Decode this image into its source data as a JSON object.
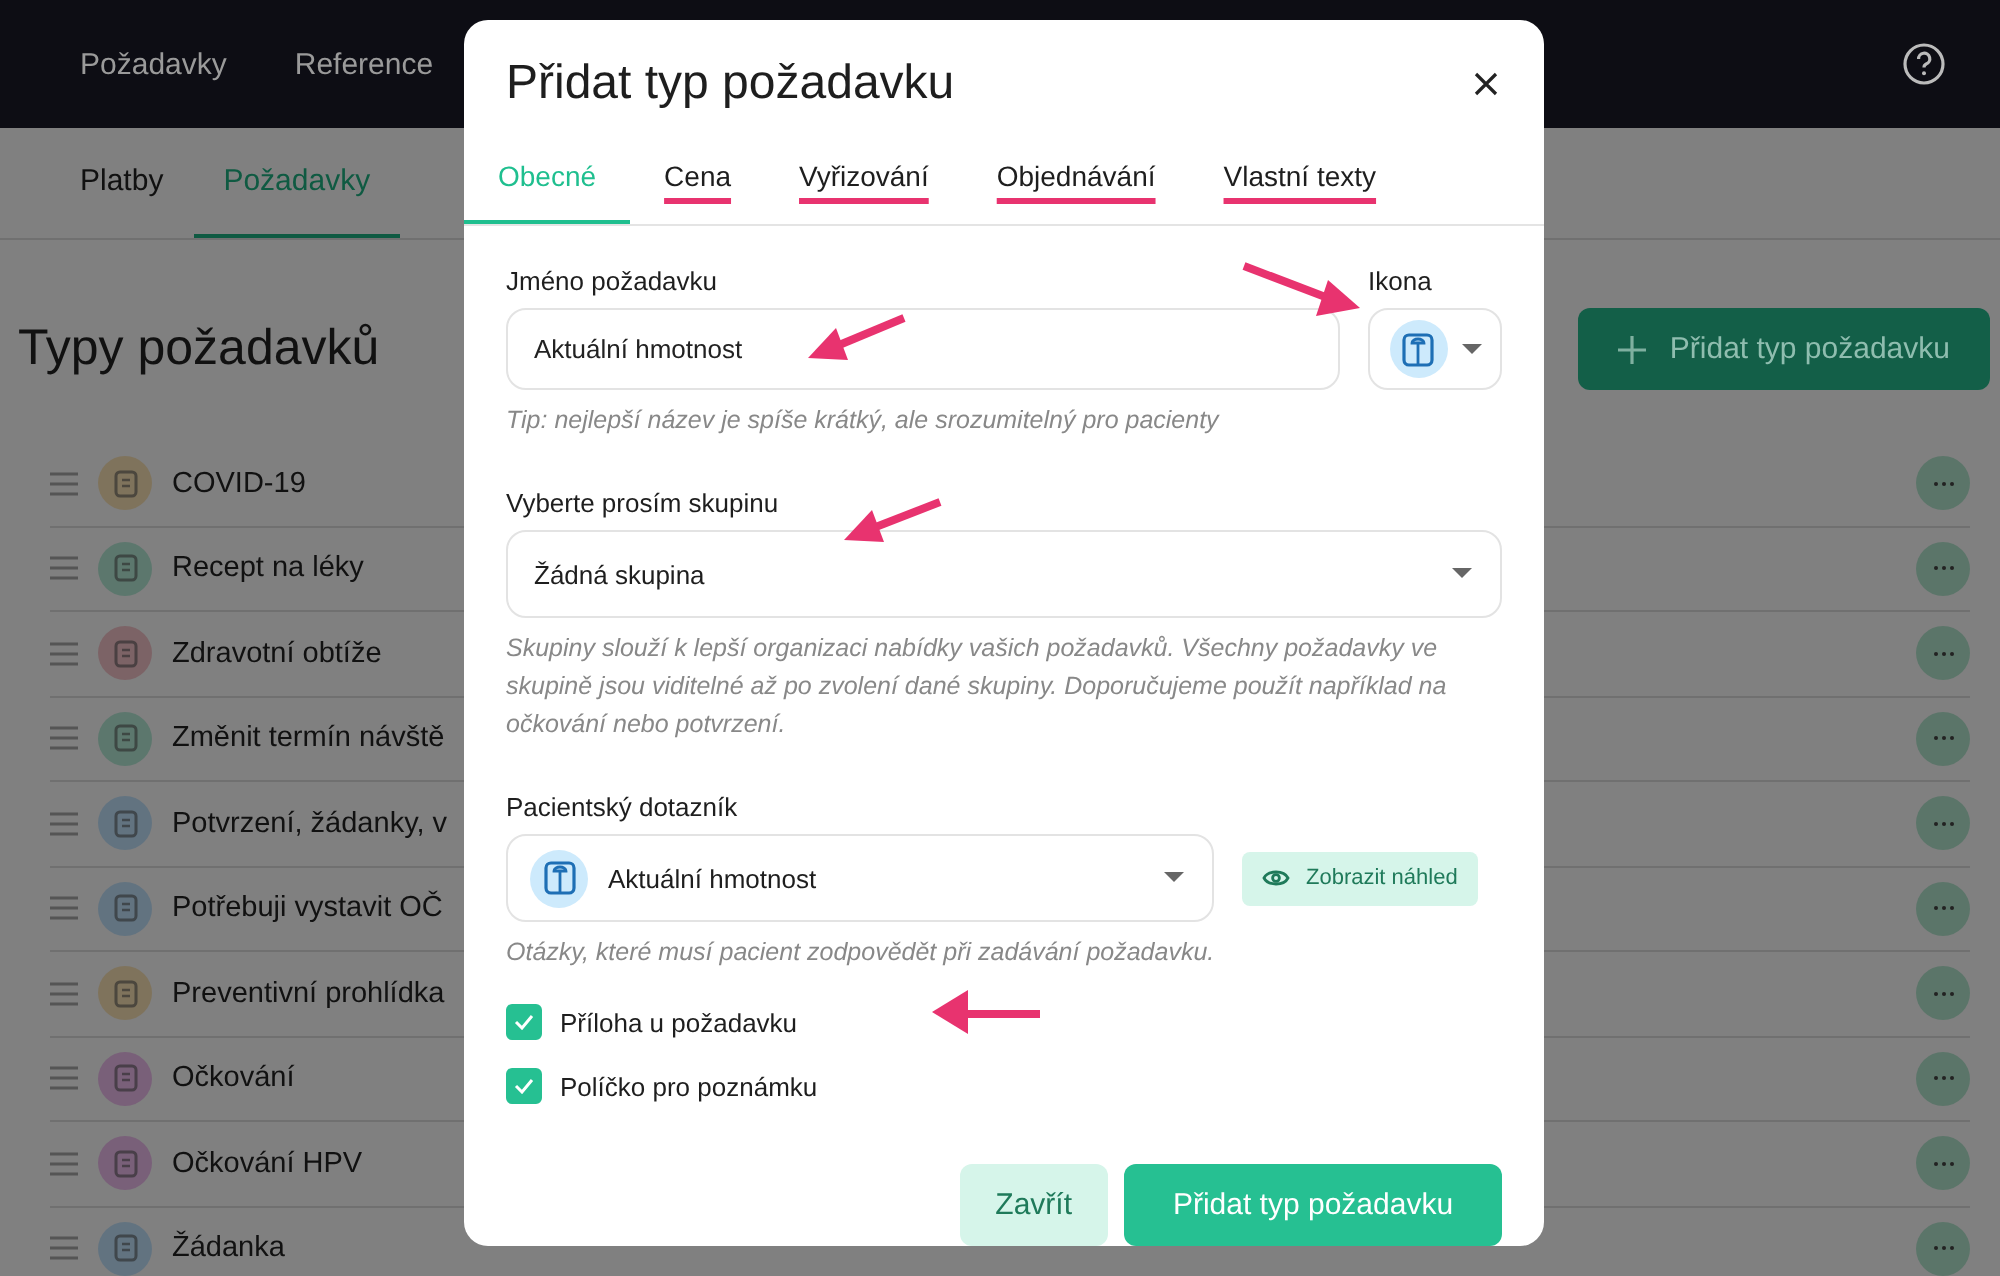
{
  "nav": {
    "items": [
      {
        "label": "Požadavky"
      },
      {
        "label": "Reference"
      }
    ]
  },
  "subnav": {
    "tabs": [
      {
        "label": "Platby",
        "selected": false
      },
      {
        "label": "Požadavky",
        "selected": true
      }
    ]
  },
  "page": {
    "title": "Typy požadavků",
    "add_button": "Přidat typ požadavku"
  },
  "request_types": [
    {
      "name": "COVID-19",
      "color": "#7f735c"
    },
    {
      "name": "Recept na léky",
      "color": "#5c776d"
    },
    {
      "name": "Zdravotní obtíže",
      "color": "#7c6366"
    },
    {
      "name": "Změnit termín návště",
      "color": "#5c776d"
    },
    {
      "name": "Potvrzení, žádanky, v",
      "color": "#627380"
    },
    {
      "name": "Potřebuji vystavit OČ",
      "color": "#627380"
    },
    {
      "name": "Preventivní prohlídka",
      "color": "#7f735c"
    },
    {
      "name": "Očkování",
      "color": "#796079"
    },
    {
      "name": "Očkování HPV",
      "color": "#796079"
    },
    {
      "name": "Žádanka",
      "color": "#627380"
    }
  ],
  "dialog": {
    "title": "Přidat typ požadavku",
    "tabs": [
      {
        "label": "Obecné",
        "selected": true,
        "highlighted": false
      },
      {
        "label": "Cena",
        "selected": false,
        "highlighted": true
      },
      {
        "label": "Vyřizování",
        "selected": false,
        "highlighted": true
      },
      {
        "label": "Objednávání",
        "selected": false,
        "highlighted": true
      },
      {
        "label": "Vlastní texty",
        "selected": false,
        "highlighted": true
      }
    ],
    "name_label": "Jméno požadavku",
    "name_value": "Aktuální hmotnost",
    "icon_label": "Ikona",
    "name_hint": "Tip: nejlepší název je spíše krátký, ale srozumitelný pro pacienty",
    "group_label": "Vyberte prosím skupinu",
    "group_value": "Žádná skupina",
    "group_hint": "Skupiny slouží k lepší organizaci nabídky vašich požadavků. Všechny požadavky ve skupině jsou viditelné až po zvolení dané skupiny. Doporučujeme použít například na očkování nebo potvrzení.",
    "questionnaire_label": "Pacientský dotazník",
    "questionnaire_value": "Aktuální hmotnost",
    "preview_button": "Zobrazit náhled",
    "questionnaire_hint": "Otázky, které musí pacient zodpovědět při zadávání požadavku.",
    "options": [
      {
        "label": "Příloha u požadavku",
        "checked": true
      },
      {
        "label": "Políčko pro poznámku",
        "checked": true
      }
    ],
    "close_button": "Zavřít",
    "submit_button": "Přidat typ požadavku"
  }
}
